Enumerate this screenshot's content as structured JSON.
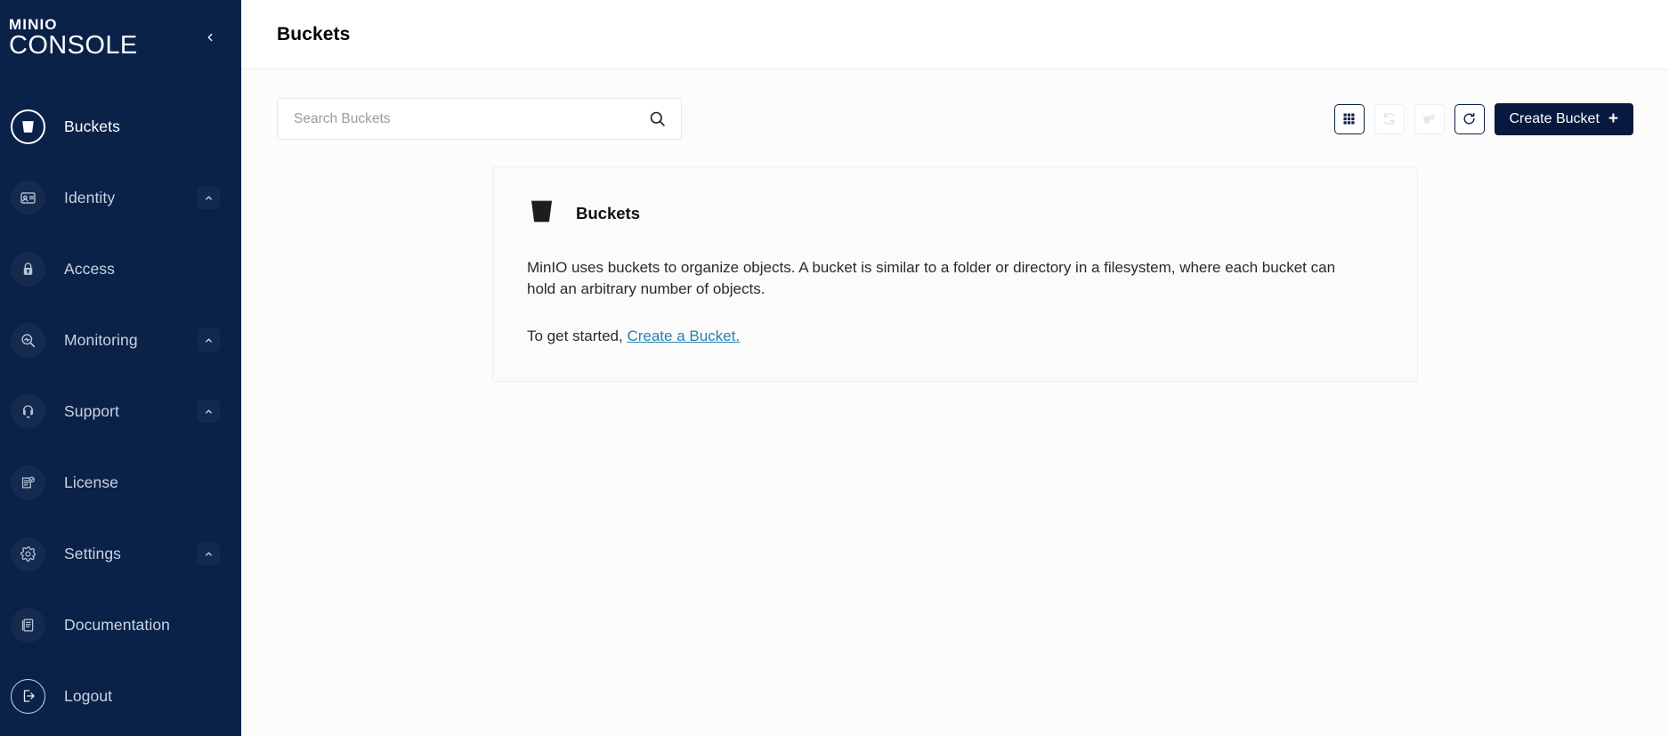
{
  "sidebar": {
    "logo": {
      "top": "MINIO",
      "bottom": "CONSOLE"
    },
    "collapse_label": "collapse-sidebar",
    "items": [
      {
        "label": "Buckets",
        "icon": "bucket-icon",
        "active": true,
        "caret": false
      },
      {
        "label": "Identity",
        "icon": "id-card-icon",
        "active": false,
        "caret": true
      },
      {
        "label": "Access",
        "icon": "lock-icon",
        "active": false,
        "caret": false
      },
      {
        "label": "Monitoring",
        "icon": "monitoring-icon",
        "active": false,
        "caret": true
      },
      {
        "label": "Support",
        "icon": "headset-icon",
        "active": false,
        "caret": true
      },
      {
        "label": "License",
        "icon": "license-doc-icon",
        "active": false,
        "caret": false
      },
      {
        "label": "Settings",
        "icon": "gear-icon",
        "active": false,
        "caret": true
      },
      {
        "label": "Documentation",
        "icon": "book-icon",
        "active": false,
        "caret": false
      },
      {
        "label": "Logout",
        "icon": "logout-icon",
        "active": false,
        "caret": false
      }
    ]
  },
  "header": {
    "title": "Buckets"
  },
  "search": {
    "value": "",
    "placeholder": "Search Buckets",
    "icon": "search-icon"
  },
  "toolbar": {
    "grid_view": {
      "name": "grid-view-icon",
      "disabled": false
    },
    "sync": {
      "name": "sync-icon",
      "disabled": true
    },
    "lifecycle": {
      "name": "multi-bucket-icon",
      "disabled": true
    },
    "refresh": {
      "name": "refresh-icon",
      "disabled": false
    },
    "create_label": "Create Bucket",
    "create_plus": "+"
  },
  "card": {
    "icon": "bucket-icon",
    "title": "Buckets",
    "body": "MinIO uses buckets to organize objects. A bucket is similar to a folder or directory in a filesystem, where each bucket can hold an arbitrary number of objects.",
    "cta_prefix": "To get started, ",
    "cta_link": "Create a Bucket."
  },
  "colors": {
    "sidebar_bg": "#0a2148",
    "accent_dark": "#07193e",
    "link_blue": "#2781b0",
    "text": "#2a2a2a"
  }
}
